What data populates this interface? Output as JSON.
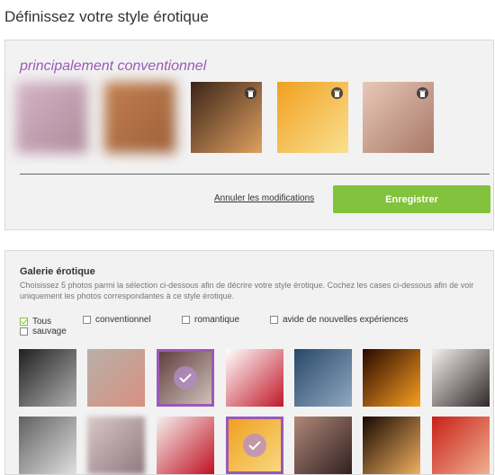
{
  "page": {
    "title": "Définissez votre style érotique"
  },
  "selection": {
    "style_name": "principalement conventionnel",
    "photos": [
      {
        "name": "selected-photo-1",
        "blurred": true,
        "colors": [
          "#d4b4c6",
          "#b08a9a"
        ]
      },
      {
        "name": "selected-photo-2",
        "blurred": true,
        "colors": [
          "#c08050",
          "#a0603a"
        ]
      },
      {
        "name": "selected-photo-3",
        "blurred": false,
        "colors": [
          "#3a2418",
          "#e0a060"
        ],
        "icon": "trash-icon"
      },
      {
        "name": "selected-photo-4",
        "blurred": false,
        "colors": [
          "#f0a020",
          "#fae090"
        ],
        "icon": "trash-icon"
      },
      {
        "name": "selected-photo-5",
        "blurred": false,
        "colors": [
          "#e8c8b8",
          "#a87868"
        ],
        "icon": "trash-icon"
      }
    ],
    "cancel_label": "Annuler les modifications",
    "save_label": "Enregistrer"
  },
  "gallery": {
    "title": "Galerie érotique",
    "description": "Choisissez 5 photos parmi la sélection ci-dessous afin de décrire votre style érotique. Cochez les cases ci-dessous afin de voir uniquement les photos correspondantes à ce style érotique.",
    "filters": [
      {
        "label": "Tous",
        "label2": "sauvage",
        "checked": true
      },
      {
        "label": "conventionnel",
        "checked": false
      },
      {
        "label": "romantique",
        "checked": false
      },
      {
        "label": "avide de nouvelles expériences",
        "checked": false
      }
    ],
    "rows": [
      [
        {
          "colors": [
            "#202020",
            "#b0b0b0"
          ],
          "selected": false
        },
        {
          "colors": [
            "#b8b0a8",
            "#d89080"
          ],
          "selected": false
        },
        {
          "colors": [
            "#604040",
            "#d0c0b8"
          ],
          "selected": true
        },
        {
          "colors": [
            "#ffffff",
            "#c01828"
          ],
          "selected": false
        },
        {
          "colors": [
            "#284868",
            "#90a8c0"
          ],
          "selected": false
        },
        {
          "colors": [
            "#2a0800",
            "#f8a020"
          ],
          "selected": false
        },
        {
          "colors": [
            "#f4f0ee",
            "#302828"
          ],
          "selected": false
        }
      ],
      [
        {
          "colors": [
            "#606060",
            "#e0e0e0"
          ],
          "selected": false
        },
        {
          "colors": [
            "#d8c8c8",
            "#907880"
          ],
          "selected": false
        },
        {
          "colors": [
            "#f4f0ee",
            "#c01020"
          ],
          "selected": false
        },
        {
          "colors": [
            "#f0a020",
            "#f8d880"
          ],
          "selected": true
        },
        {
          "colors": [
            "#b08878",
            "#302020"
          ],
          "selected": false
        },
        {
          "colors": [
            "#180800",
            "#f0b060"
          ],
          "selected": false
        },
        {
          "colors": [
            "#c82018",
            "#f0b090"
          ],
          "selected": false
        }
      ]
    ],
    "check_icon": "check-icon"
  }
}
